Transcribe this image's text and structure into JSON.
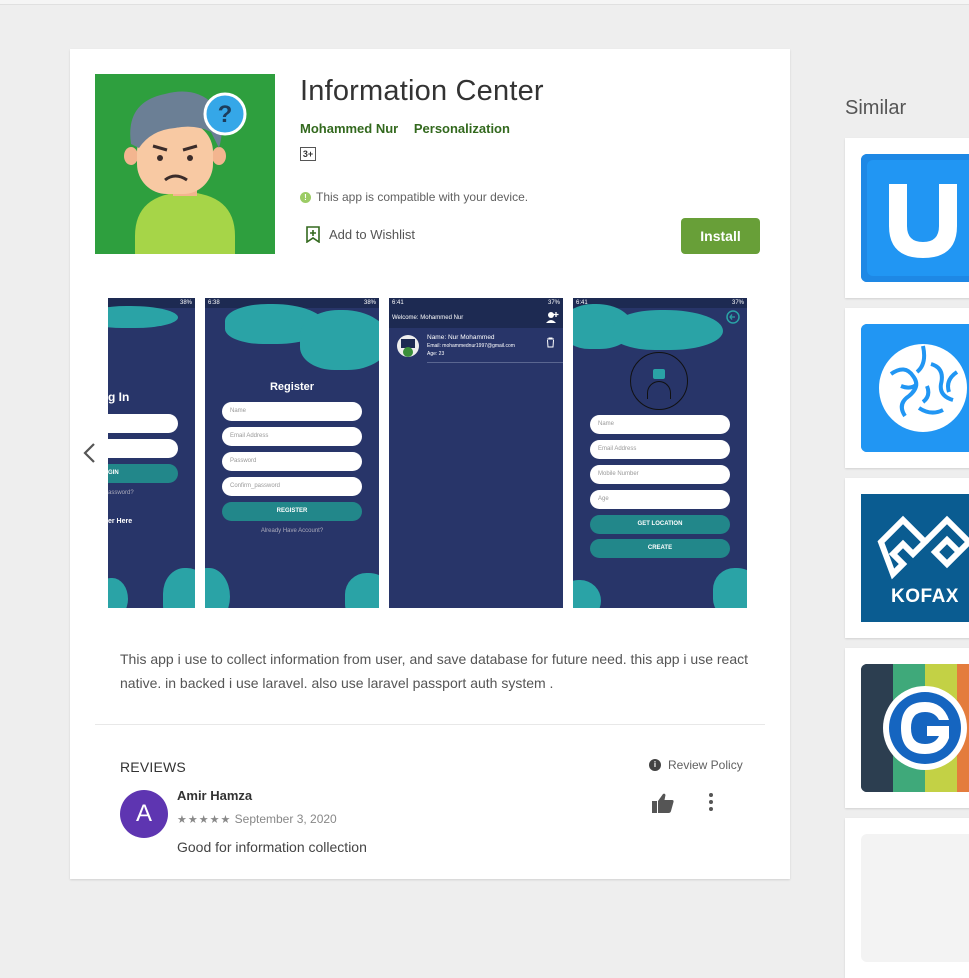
{
  "app": {
    "title": "Information Center",
    "developer": "Mohammed Nur",
    "category": "Personalization",
    "content_rating": "3+",
    "compatibility": "This app is compatible with your device.",
    "wishlist_label": "Add to Wishlist",
    "install_label": "Install",
    "description": "This app i use to collect information from user, and save database for future need. this app i use react native. in backed i use laravel. also use laravel passport auth system ."
  },
  "screenshots": {
    "login": {
      "time": "",
      "battery": "38%",
      "heading": "g In",
      "button": "GIN",
      "forgot": "assword?",
      "register_link": "er Here"
    },
    "register": {
      "time": "6:38",
      "battery": "38%",
      "heading": "Register",
      "fields": [
        "Name",
        "Email Address",
        "Password",
        "Confirm_password"
      ],
      "button": "REGISTER",
      "footer": "Already Have Account?"
    },
    "list": {
      "time": "6:41",
      "battery": "37%",
      "header": "Welcome: Mohammed Nur",
      "name": "Name: Nur Mohammed",
      "email": "Email: mohammednur1997@gmail.com",
      "age": "Age: 23"
    },
    "create": {
      "time": "6:41",
      "battery": "37%",
      "fields": [
        "Name",
        "Email Address",
        "Mobile Number",
        "Age"
      ],
      "location_button": "GET LOCATION",
      "create_button": "CREATE"
    }
  },
  "reviews": {
    "heading": "REVIEWS",
    "policy": "Review Policy",
    "items": [
      {
        "initial": "A",
        "author": "Amir Hamza",
        "stars": "★★★★★",
        "rating": 5,
        "date": "September 3, 2020",
        "text": "Good for information collection"
      }
    ]
  },
  "similar": {
    "heading": "Similar",
    "apps": [
      {
        "icon": "u-letter-icon",
        "color": "#1e88e5"
      },
      {
        "icon": "brain-icon",
        "color": "#2196f3"
      },
      {
        "icon": "kofax-logo-icon",
        "label": "KOFAX",
        "color": "#0a5c91"
      },
      {
        "icon": "g-stripes-icon",
        "color": "#2c3e50"
      }
    ]
  }
}
